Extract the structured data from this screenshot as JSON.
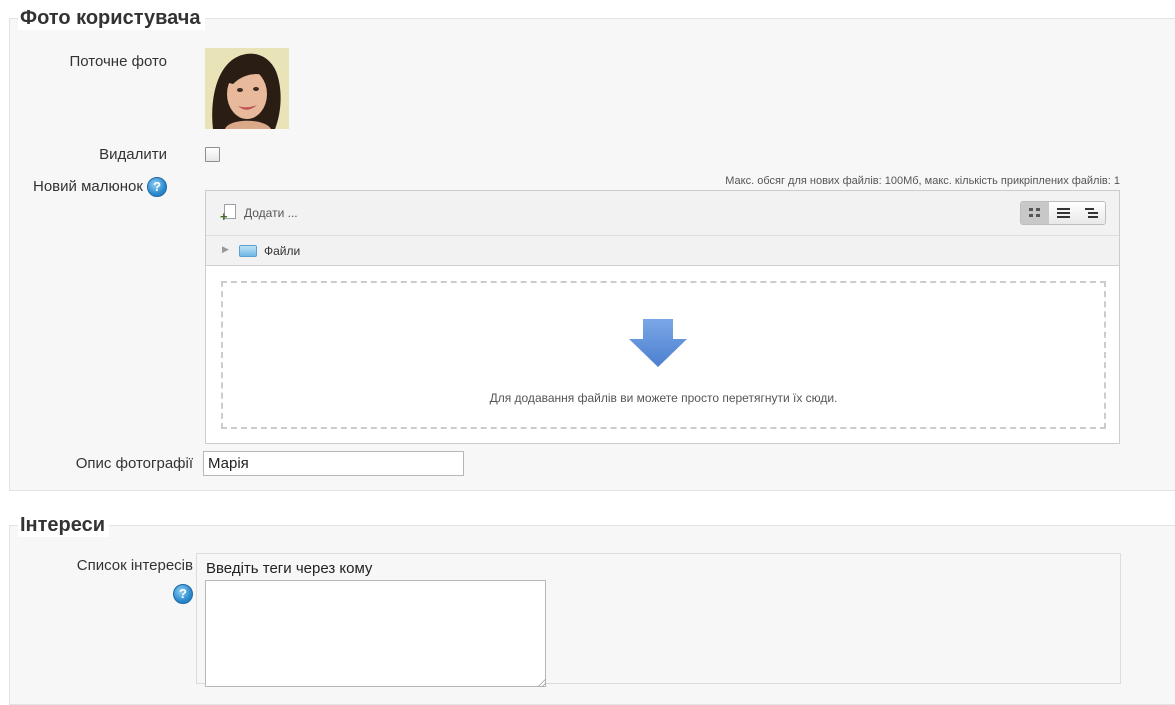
{
  "photo_section": {
    "legend": "Фото користувача",
    "current_photo_label": "Поточне фото",
    "delete_label": "Видалити",
    "delete_checked": false,
    "new_picture_label": "Новий малюнок",
    "help_glyph": "?",
    "filepicker": {
      "limits_text": "Макс. обсяг для нових файлів: 100Мб, макс. кількість прикріплених файлів: 1",
      "add_label": "Додати ...",
      "view_modes": [
        "grid-icon",
        "list-icon",
        "tree-icon"
      ],
      "active_view": "grid-icon",
      "path_label": "Файли",
      "dnd_text": "Для додавання файлів ви можете просто перетягнути їх сюди.",
      "arrow_color": "#5b8fd6"
    },
    "description_label": "Опис фотографії",
    "description_value": "Марія"
  },
  "interests_section": {
    "legend": "Інтереси",
    "list_label": "Список інтересів",
    "help_glyph": "?",
    "tags_caption": "Введіть теги через кому",
    "tags_value": ""
  }
}
